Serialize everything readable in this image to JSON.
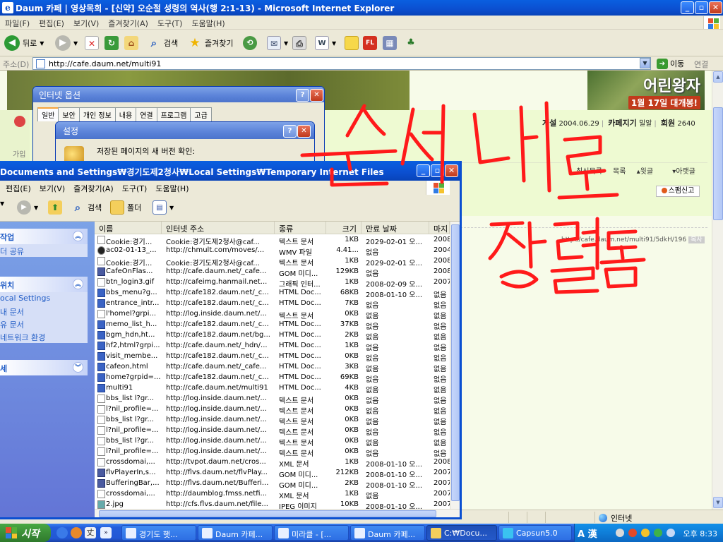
{
  "ie": {
    "title": "Daum 카페 | 영상목회 - [신약] 오순절 성령의 역사(행 2:1-13) - Microsoft Internet Explorer",
    "menu": [
      "파일(F)",
      "편집(E)",
      "보기(V)",
      "즐겨찾기(A)",
      "도구(T)",
      "도움말(H)"
    ],
    "toolbar": {
      "back": "뒤로",
      "search": "검색",
      "favorites": "즐겨찾기"
    },
    "address": {
      "label": "주소(D)",
      "value": "http://cafe.daum.net/multi91",
      "go": "이동",
      "links": "연결"
    },
    "status": {
      "zone": "인터넷"
    }
  },
  "page": {
    "ad": {
      "title": "어린왕자",
      "sub": "1월 17일 대개봉!"
    },
    "meta": {
      "posted_label": "게설",
      "posted_date": "2004.06.29",
      "cafe_label": "카페지기",
      "cafe_value": "밀알",
      "member_label": "회원",
      "member_value": "2640"
    },
    "side_join": "가입",
    "nav": [
      "최신목록",
      "목록",
      "윗글",
      "아랫글"
    ],
    "spam": "스팸신고",
    "url_tag": "http://cafe.daum.net/multi91/5dkH/196",
    "url_badge": "복사"
  },
  "options_dialog": {
    "title": "인터넷 옵션",
    "tabs": [
      "일반",
      "보안",
      "개인 정보",
      "내용",
      "연결",
      "프로그램",
      "고급"
    ]
  },
  "settings_dialog": {
    "title": "설정",
    "text": "저장된 페이지의 새 버전 확인:"
  },
  "explorer": {
    "title": "Documents and Settings₩경기도제2청사₩Local Settings₩Temporary Internet Files",
    "menu": [
      "편집(E)",
      "보기(V)",
      "즐겨찾기(A)",
      "도구(T)",
      "도움말(H)"
    ],
    "toolbar": {
      "search": "검색",
      "folders": "폴더"
    },
    "panels": [
      {
        "head": "작업",
        "items": [
          "더 공유"
        ]
      },
      {
        "head": "위치",
        "items": [
          "ocal Settings",
          "내 문서",
          "유 문서",
          "네트워크 환경"
        ]
      },
      {
        "head": "세",
        "items": []
      }
    ],
    "columns": [
      "이름",
      "인터넷 주소",
      "종류",
      "크기",
      "만료 날짜",
      "마지"
    ],
    "rows": [
      {
        "name": "Cookie:경기...",
        "url": "Cookie:경기도제2청사@caf...",
        "type": "텍스트 문서",
        "size": "1KB",
        "exp": "2029-02-01 오...",
        "last": "2008",
        "icon": "txt"
      },
      {
        "name": "ac02-01-13_...",
        "url": "http://chmult.com/moves/...",
        "type": "WMV 파일",
        "size": "4.41...",
        "exp": "없음",
        "last": "2004",
        "icon": "red"
      },
      {
        "name": "Cookie:경기...",
        "url": "Cookie:경기도제2청사@caf...",
        "type": "텍스트 문서",
        "size": "1KB",
        "exp": "2029-02-01 오...",
        "last": "2008",
        "icon": "txt"
      },
      {
        "name": "CafeOnFlas...",
        "url": "http://cafe.daum.net/_cafe...",
        "type": "GOM 미디...",
        "size": "129KB",
        "exp": "없음",
        "last": "2008",
        "icon": "gom"
      },
      {
        "name": "btn_login3.gif",
        "url": "http://cafeimg.hanmail.net...",
        "type": "그래픽 인터...",
        "size": "1KB",
        "exp": "2008-02-09 오...",
        "last": "2007",
        "icon": "txt"
      },
      {
        "name": "bbs_menu?g...",
        "url": "http://cafe182.daum.net/_c...",
        "type": "HTML Doc...",
        "size": "68KB",
        "exp": "2008-01-10 오...",
        "last": "없음",
        "icon": "blue"
      },
      {
        "name": "entrance_intr...",
        "url": "http://cafe182.daum.net/_c...",
        "type": "HTML Doc...",
        "size": "7KB",
        "exp": "없음",
        "last": "없음",
        "icon": "blue"
      },
      {
        "name": "l'homel?grpi...",
        "url": "http://log.inside.daum.net/...",
        "type": "텍스트 문서",
        "size": "0KB",
        "exp": "없음",
        "last": "없음",
        "icon": "txt"
      },
      {
        "name": "memo_list_h...",
        "url": "http://cafe182.daum.net/_c...",
        "type": "HTML Doc...",
        "size": "37KB",
        "exp": "없음",
        "last": "없음",
        "icon": "blue"
      },
      {
        "name": "bgm_hdn,ht...",
        "url": "http://cafe182.daum.net/bg...",
        "type": "HTML Doc...",
        "size": "2KB",
        "exp": "없음",
        "last": "없음",
        "icon": "blue"
      },
      {
        "name": "hf2,html?grpi...",
        "url": "http://cafe.daum.net/_hdn/...",
        "type": "HTML Doc...",
        "size": "1KB",
        "exp": "없음",
        "last": "없음",
        "icon": "blue"
      },
      {
        "name": "visit_membe...",
        "url": "http://cafe182.daum.net/_c...",
        "type": "HTML Doc...",
        "size": "0KB",
        "exp": "없음",
        "last": "없음",
        "icon": "blue"
      },
      {
        "name": "cafeon,html",
        "url": "http://cafe.daum.net/_cafe...",
        "type": "HTML Doc...",
        "size": "3KB",
        "exp": "없음",
        "last": "없음",
        "icon": "blue"
      },
      {
        "name": "home?grpid=...",
        "url": "http://cafe182.daum.net/_c...",
        "type": "HTML Doc...",
        "size": "69KB",
        "exp": "없음",
        "last": "없음",
        "icon": "blue"
      },
      {
        "name": "multi91",
        "url": "http://cafe.daum.net/multi91",
        "type": "HTML Doc...",
        "size": "4KB",
        "exp": "없음",
        "last": "없음",
        "icon": "blue"
      },
      {
        "name": "bbs_list l?gr...",
        "url": "http://log.inside.daum.net/...",
        "type": "텍스트 문서",
        "size": "0KB",
        "exp": "없음",
        "last": "없음",
        "icon": "txt"
      },
      {
        "name": "l?nil_profile=...",
        "url": "http://log.inside.daum.net/...",
        "type": "텍스트 문서",
        "size": "0KB",
        "exp": "없음",
        "last": "없음",
        "icon": "txt"
      },
      {
        "name": "bbs_list l?gr...",
        "url": "http://log.inside.daum.net/...",
        "type": "텍스트 문서",
        "size": "0KB",
        "exp": "없음",
        "last": "없음",
        "icon": "txt"
      },
      {
        "name": "l?nil_profile=...",
        "url": "http://log.inside.daum.net/...",
        "type": "텍스트 문서",
        "size": "0KB",
        "exp": "없음",
        "last": "없음",
        "icon": "txt"
      },
      {
        "name": "bbs_list l?gr...",
        "url": "http://log.inside.daum.net/...",
        "type": "텍스트 문서",
        "size": "0KB",
        "exp": "없음",
        "last": "없음",
        "icon": "txt"
      },
      {
        "name": "l?nil_profile=...",
        "url": "http://log.inside.daum.net/...",
        "type": "텍스트 문서",
        "size": "0KB",
        "exp": "없음",
        "last": "없음",
        "icon": "txt"
      },
      {
        "name": "crossdomai,...",
        "url": "http://tvpot.daum.net/cros...",
        "type": "XML 문서",
        "size": "1KB",
        "exp": "2008-01-10 오...",
        "last": "2008",
        "icon": "txt"
      },
      {
        "name": "flvPlayerIn,s...",
        "url": "http://flvs.daum.net/flvPlay...",
        "type": "GOM 미디...",
        "size": "212KB",
        "exp": "2008-01-10 오...",
        "last": "2007",
        "icon": "gom"
      },
      {
        "name": "BufferingBar,...",
        "url": "http://flvs.daum.net/Bufferi...",
        "type": "GOM 미디...",
        "size": "2KB",
        "exp": "2008-01-10 오...",
        "last": "2007",
        "icon": "gom"
      },
      {
        "name": "crossdomai,...",
        "url": "http://daumblog.fmss.netfi...",
        "type": "XML 문서",
        "size": "1KB",
        "exp": "없음",
        "last": "2007",
        "icon": "txt"
      },
      {
        "name": "2.jpg",
        "url": "http://cfs.flvs.daum.net/file...",
        "type": "JPEG 이미지",
        "size": "10KB",
        "exp": "2008-01-10 오...",
        "last": "2007",
        "icon": "jpg"
      }
    ]
  },
  "taskbar": {
    "start": "시작",
    "buttons": [
      "경기도 햇...",
      "Daum 카페...",
      "미라클 - [...",
      "Daum 카페...",
      "C:₩Docu...",
      "Capsun5.0"
    ],
    "ime": "A 漢",
    "clock": "오후 8:33"
  },
  "annotation": {
    "line1": "순서대로",
    "line2": "정렬됨",
    "color": "#ff1a1a"
  }
}
